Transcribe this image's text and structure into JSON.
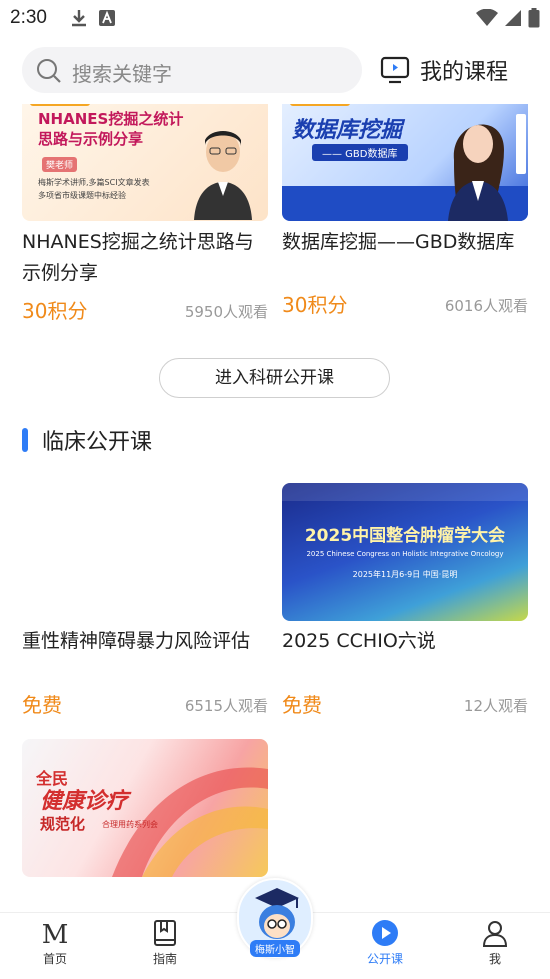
{
  "status_bar": {
    "time": "2:30"
  },
  "search": {
    "placeholder": "搜索关键字"
  },
  "header": {
    "my_courses": "我的课程"
  },
  "research_cards": [
    {
      "title": "NHANES挖掘之统计思路与示例分享",
      "price": "30积分",
      "views": "5950人观看",
      "thumb_text": [
        "NHANES挖掘之统计",
        "思路与示例分享",
        "樊老师",
        "梅斯学术讲师,多篇SCI文章发表",
        "多项省市级课题中标经验"
      ]
    },
    {
      "title": "数据库挖掘——GBD数据库",
      "price": "30积分",
      "views": "6016人观看",
      "thumb_text": [
        "数据库挖掘",
        "—— GBD数据库"
      ]
    }
  ],
  "enter_button": "进入科研公开课",
  "clinical_section": {
    "title": "临床公开课"
  },
  "clinical_cards": [
    {
      "title": "重性精神障碍暴力风险评估",
      "price": "免费",
      "views": "6515人观看"
    },
    {
      "title": "2025 CCHIO六说",
      "price": "免费",
      "views": "12人观看",
      "thumb_text": [
        "2025中国整合肿瘤学大会",
        "2025 Chinese Congress on Holistic Integrative Oncology",
        "2025年11月6-9日   中国·昆明"
      ]
    },
    {
      "thumb_text": [
        "全民",
        "健康诊疗",
        "规范化",
        "合理用药系列会"
      ]
    }
  ],
  "bottom_nav": [
    {
      "label": "首页",
      "icon": "m-logo-icon"
    },
    {
      "label": "指南",
      "icon": "book-icon"
    },
    {
      "label": "梅斯小智",
      "icon": "mascot-icon"
    },
    {
      "label": "公开课",
      "icon": "play-icon",
      "active": true
    },
    {
      "label": "我",
      "icon": "user-icon"
    }
  ],
  "colors": {
    "accent": "#2e7cf6",
    "price": "#f08a1a"
  }
}
